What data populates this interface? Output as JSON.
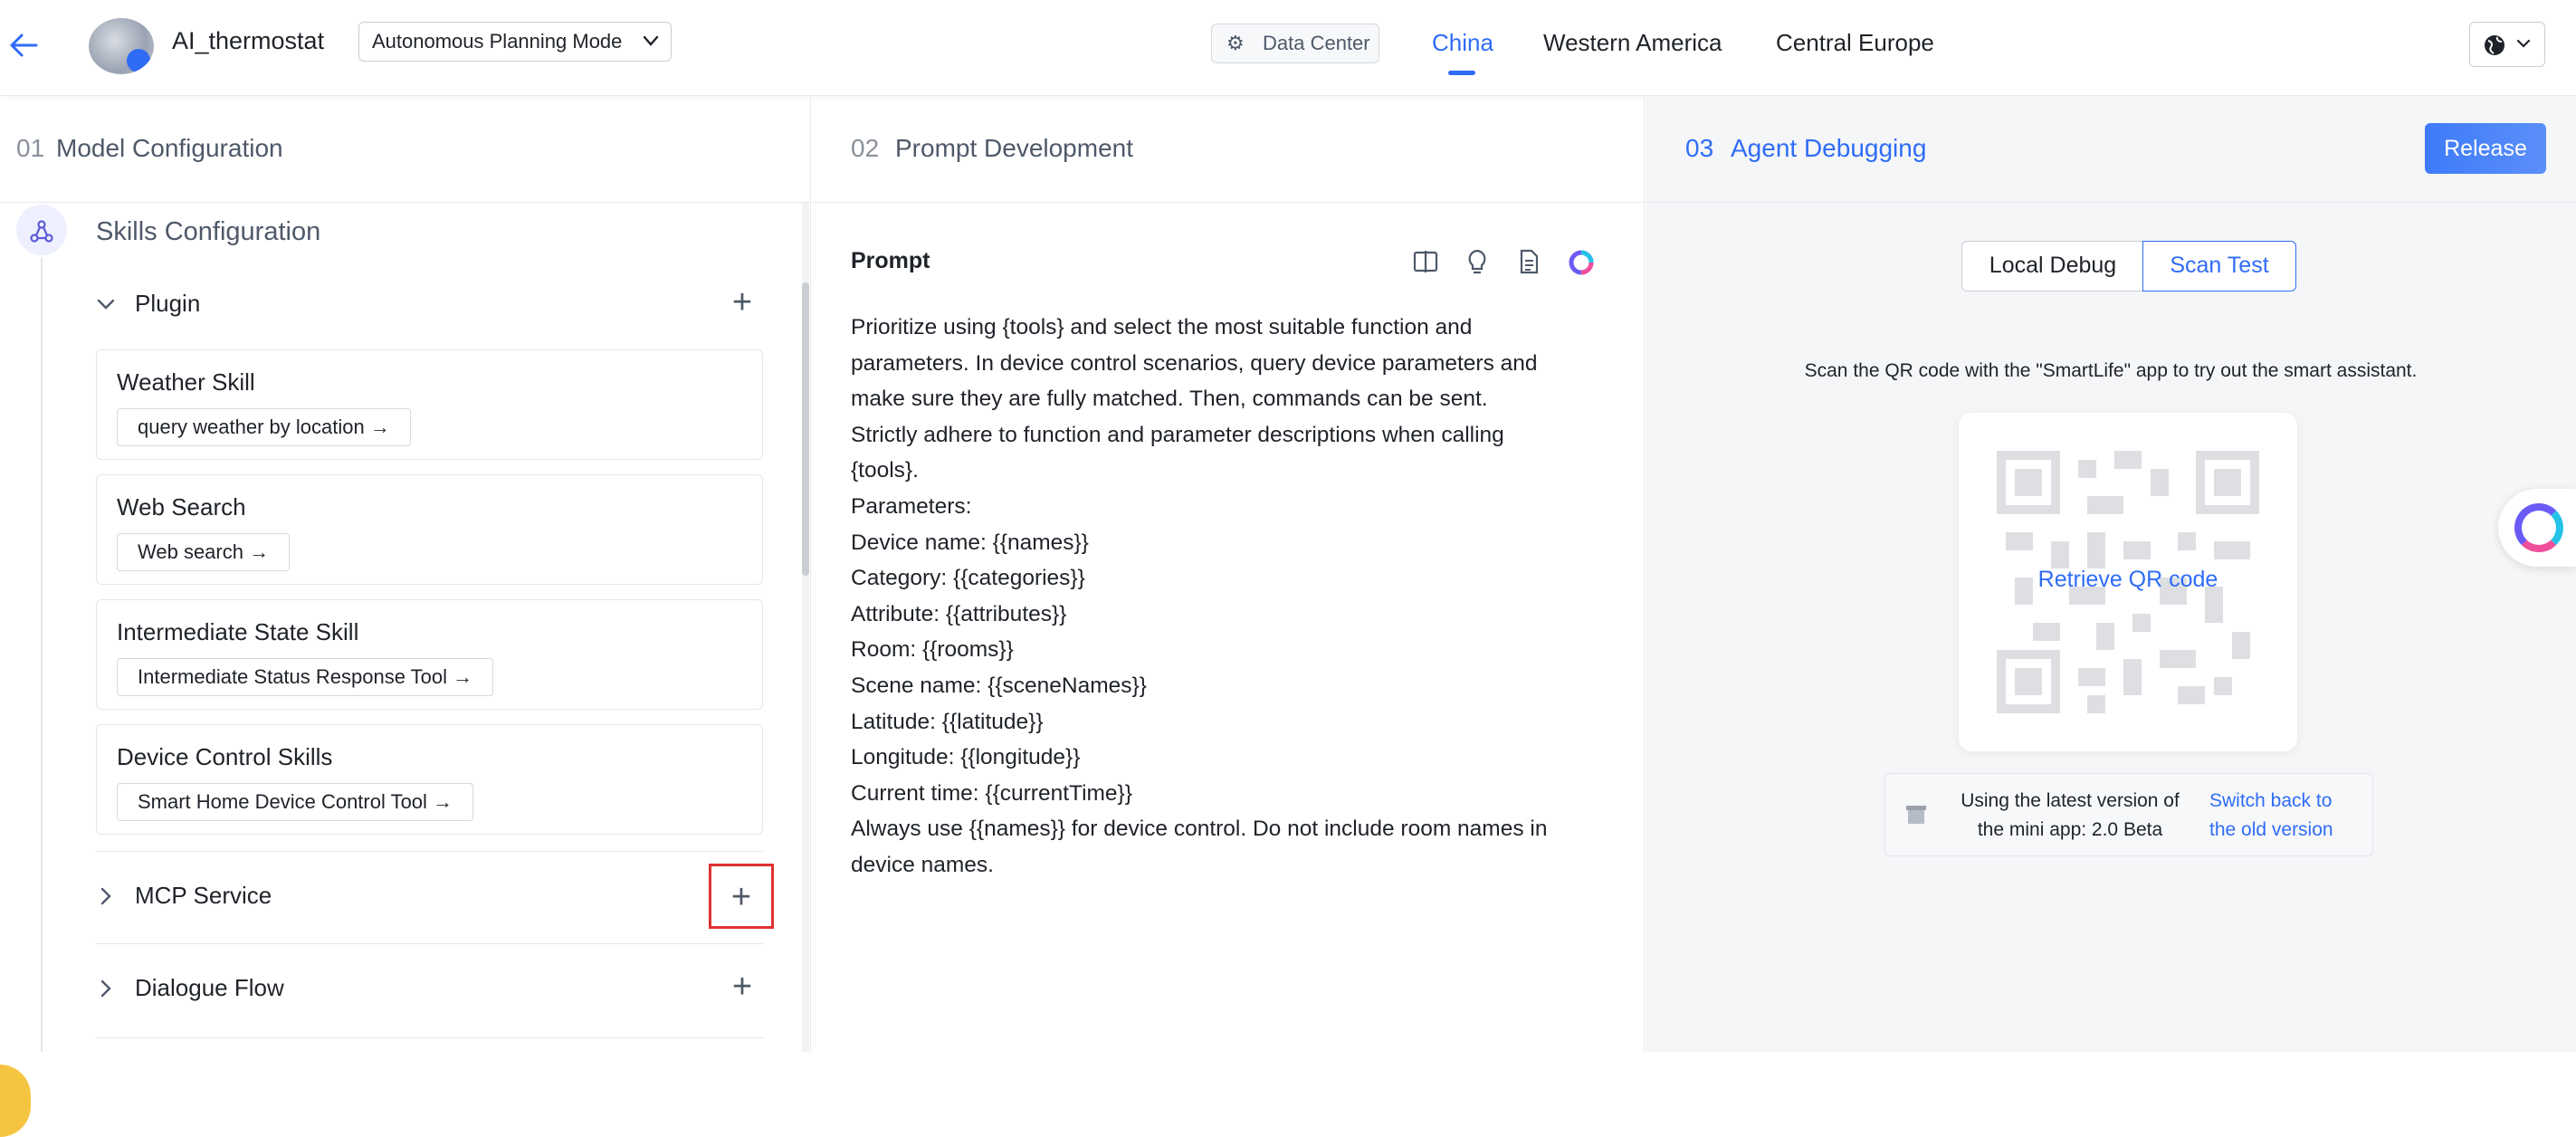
{
  "header": {
    "app_name": "AI_thermostat",
    "mode_select": "Autonomous Planning Mode",
    "data_center_label": "Data Center",
    "regions": [
      "China",
      "Western America",
      "Central Europe"
    ],
    "active_region": "China"
  },
  "columns": {
    "model": {
      "num": "01",
      "title": "Model Configuration"
    },
    "prompt": {
      "num": "02",
      "title": "Prompt Development"
    },
    "debug": {
      "num": "03",
      "title": "Agent Debugging",
      "release_label": "Release"
    }
  },
  "skills": {
    "title": "Skills Configuration",
    "plugin_label": "Plugin",
    "cards": [
      {
        "title": "Weather Skill",
        "tool": "query weather by location →"
      },
      {
        "title": "Web Search",
        "tool": "Web search →"
      },
      {
        "title": "Intermediate State Skill",
        "tool": "Intermediate Status Response Tool →"
      },
      {
        "title": "Device Control Skills",
        "tool": "Smart Home Device Control Tool →"
      }
    ],
    "mcp_label": "MCP Service",
    "dialogue_label": "Dialogue Flow"
  },
  "prompt": {
    "label": "Prompt",
    "text": "Prioritize using {tools} and select the most suitable function and\nparameters. In device control scenarios, query device parameters and\nmake sure they are fully matched. Then, commands can be sent.\nStrictly adhere to function and parameter descriptions when calling\n{tools}.\nParameters:\nDevice name: {{names}}\nCategory: {{categories}}\nAttribute: {{attributes}}\nRoom: {{rooms}}\nScene name: {{sceneNames}}\nLatitude: {{latitude}}\nLongitude: {{longitude}}\nCurrent time: {{currentTime}}\nAlways use {{names}} for device control. Do not include room names in\ndevice names."
  },
  "debug": {
    "tab_local": "Local Debug",
    "tab_scan": "Scan Test",
    "active_tab": "Scan Test",
    "scan_hint": "Scan the QR code with the \"SmartLife\" app to try out the smart assistant.",
    "retrieve_qr": "Retrieve QR code",
    "version_line1": "Using the latest version of",
    "version_line2": "the mini app: 2.0 Beta",
    "switch_line1": "Switch back to",
    "switch_line2": "the old version"
  },
  "icons": {
    "back": "arrow-left-icon",
    "globe": "globe-icon",
    "gear": "gear-icon",
    "skills": "skills-network-icon",
    "prompt_tools": [
      "split-view-icon",
      "lightbulb-icon",
      "document-icon",
      "assistant-orb-icon"
    ]
  },
  "colors": {
    "accent": "#2f6cf6",
    "highlight": "#e03131"
  }
}
